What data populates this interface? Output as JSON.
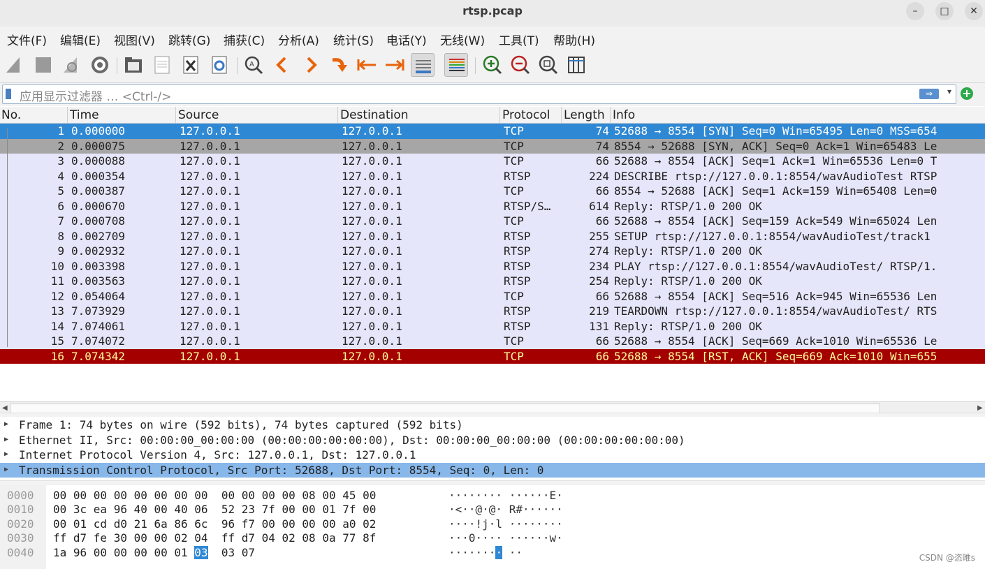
{
  "window": {
    "title": "rtsp.pcap"
  },
  "window_controls": {
    "minimize": "–",
    "maximize": "□",
    "close": "✕"
  },
  "menu": [
    "文件(F)",
    "编辑(E)",
    "视图(V)",
    "跳转(G)",
    "捕获(C)",
    "分析(A)",
    "统计(S)",
    "电话(Y)",
    "无线(W)",
    "工具(T)",
    "帮助(H)"
  ],
  "toolbar_icons": [
    "shark-fin-start-icon",
    "stop-square-icon",
    "shark-fin-restart-icon",
    "capture-options-gear-icon",
    "open-folder-icon",
    "save-file-icon",
    "close-file-icon",
    "reload-file-icon",
    "find-packet-icon",
    "go-back-icon",
    "go-forward-icon",
    "go-to-packet-icon",
    "go-first-icon",
    "go-last-icon",
    "autoscroll-icon",
    "colorize-icon",
    "zoom-in-icon",
    "zoom-out-icon",
    "normal-size-icon",
    "resize-columns-icon"
  ],
  "filter": {
    "placeholder": "应用显示过滤器 … <Ctrl-/>",
    "apply_arrow": "⇒",
    "dropdown": "▾",
    "add": "+"
  },
  "columns": [
    "No.",
    "Time",
    "Source",
    "Destination",
    "Protocol",
    "Length",
    "Info"
  ],
  "packets": [
    {
      "no": "1",
      "time": "0.000000",
      "src": "127.0.0.1",
      "dst": "127.0.0.1",
      "proto": "TCP",
      "len": "74",
      "info": "52688 → 8554 [SYN] Seq=0 Win=65495 Len=0 MSS=654",
      "style": "sel"
    },
    {
      "no": "2",
      "time": "0.000075",
      "src": "127.0.0.1",
      "dst": "127.0.0.1",
      "proto": "TCP",
      "len": "74",
      "info": "8554 → 52688 [SYN, ACK] Seq=0 Ack=1 Win=65483 Le",
      "style": "gray"
    },
    {
      "no": "3",
      "time": "0.000088",
      "src": "127.0.0.1",
      "dst": "127.0.0.1",
      "proto": "TCP",
      "len": "66",
      "info": "52688 → 8554 [ACK] Seq=1 Ack=1 Win=65536 Len=0 T",
      "style": "normal"
    },
    {
      "no": "4",
      "time": "0.000354",
      "src": "127.0.0.1",
      "dst": "127.0.0.1",
      "proto": "RTSP",
      "len": "224",
      "info": "DESCRIBE rtsp://127.0.0.1:8554/wavAudioTest RTSP",
      "style": "normal"
    },
    {
      "no": "5",
      "time": "0.000387",
      "src": "127.0.0.1",
      "dst": "127.0.0.1",
      "proto": "TCP",
      "len": "66",
      "info": "8554 → 52688 [ACK] Seq=1 Ack=159 Win=65408 Len=0",
      "style": "normal"
    },
    {
      "no": "6",
      "time": "0.000670",
      "src": "127.0.0.1",
      "dst": "127.0.0.1",
      "proto": "RTSP/S…",
      "len": "614",
      "info": "Reply: RTSP/1.0 200 OK",
      "style": "normal"
    },
    {
      "no": "7",
      "time": "0.000708",
      "src": "127.0.0.1",
      "dst": "127.0.0.1",
      "proto": "TCP",
      "len": "66",
      "info": "52688 → 8554 [ACK] Seq=159 Ack=549 Win=65024 Len",
      "style": "normal"
    },
    {
      "no": "8",
      "time": "0.002709",
      "src": "127.0.0.1",
      "dst": "127.0.0.1",
      "proto": "RTSP",
      "len": "255",
      "info": "SETUP rtsp://127.0.0.1:8554/wavAudioTest/track1",
      "style": "normal"
    },
    {
      "no": "9",
      "time": "0.002932",
      "src": "127.0.0.1",
      "dst": "127.0.0.1",
      "proto": "RTSP",
      "len": "274",
      "info": "Reply: RTSP/1.0 200 OK",
      "style": "normal"
    },
    {
      "no": "10",
      "time": "0.003398",
      "src": "127.0.0.1",
      "dst": "127.0.0.1",
      "proto": "RTSP",
      "len": "234",
      "info": "PLAY rtsp://127.0.0.1:8554/wavAudioTest/ RTSP/1.",
      "style": "normal"
    },
    {
      "no": "11",
      "time": "0.003563",
      "src": "127.0.0.1",
      "dst": "127.0.0.1",
      "proto": "RTSP",
      "len": "254",
      "info": "Reply: RTSP/1.0 200 OK",
      "style": "normal"
    },
    {
      "no": "12",
      "time": "0.054064",
      "src": "127.0.0.1",
      "dst": "127.0.0.1",
      "proto": "TCP",
      "len": "66",
      "info": "52688 → 8554 [ACK] Seq=516 Ack=945 Win=65536 Len",
      "style": "normal"
    },
    {
      "no": "13",
      "time": "7.073929",
      "src": "127.0.0.1",
      "dst": "127.0.0.1",
      "proto": "RTSP",
      "len": "219",
      "info": "TEARDOWN rtsp://127.0.0.1:8554/wavAudioTest/ RTS",
      "style": "normal"
    },
    {
      "no": "14",
      "time": "7.074061",
      "src": "127.0.0.1",
      "dst": "127.0.0.1",
      "proto": "RTSP",
      "len": "131",
      "info": "Reply: RTSP/1.0 200 OK",
      "style": "normal"
    },
    {
      "no": "15",
      "time": "7.074072",
      "src": "127.0.0.1",
      "dst": "127.0.0.1",
      "proto": "TCP",
      "len": "66",
      "info": "52688 → 8554 [ACK] Seq=669 Ack=1010 Win=65536 Le",
      "style": "normal"
    },
    {
      "no": "16",
      "time": "7.074342",
      "src": "127.0.0.1",
      "dst": "127.0.0.1",
      "proto": "TCP",
      "len": "66",
      "info": "52688 → 8554 [RST, ACK] Seq=669 Ack=1010 Win=655",
      "style": "red"
    }
  ],
  "details": [
    {
      "text": "Frame 1: 74 bytes on wire (592 bits), 74 bytes captured (592 bits)",
      "selected": false
    },
    {
      "text": "Ethernet II, Src: 00:00:00_00:00:00 (00:00:00:00:00:00), Dst: 00:00:00_00:00:00 (00:00:00:00:00:00)",
      "selected": false
    },
    {
      "text": "Internet Protocol Version 4, Src: 127.0.0.1, Dst: 127.0.0.1",
      "selected": false
    },
    {
      "text": "Transmission Control Protocol, Src Port: 52688, Dst Port: 8554, Seq: 0, Len: 0",
      "selected": true
    }
  ],
  "bytes": [
    {
      "offset": "0000",
      "hex": "00 00 00 00 00 00 00 00  00 00 00 00 08 00 45 00",
      "ascii": "········ ······E·"
    },
    {
      "offset": "0010",
      "hex": "00 3c ea 96 40 00 40 06  52 23 7f 00 00 01 7f 00",
      "ascii": "·<··@·@· R#······"
    },
    {
      "offset": "0020",
      "hex": "00 01 cd d0 21 6a 86 6c  96 f7 00 00 00 00 a0 02",
      "ascii": "····!j·l ········"
    },
    {
      "offset": "0030",
      "hex": "ff d7 fe 30 00 00 02 04  ff d7 04 02 08 0a 77 8f",
      "ascii": "···0···· ······w·"
    },
    {
      "offset": "0040",
      "hex_pre": "1a 96 00 00 00 00 01 ",
      "hex_hl": "03",
      "hex_post": "  03 07",
      "ascii_pre": "·······",
      "ascii_hl": "·",
      "ascii_post": " ··"
    }
  ],
  "watermark": "CSDN @恣睢s",
  "colors": {
    "selected_row": "#2f88d4",
    "gray_row": "#a6a6a6",
    "red_row": "#a40000",
    "red_row_text": "#fffc9c",
    "tcp_row_bg": "#e6e6fa",
    "detail_sel": "#88b8ea"
  }
}
